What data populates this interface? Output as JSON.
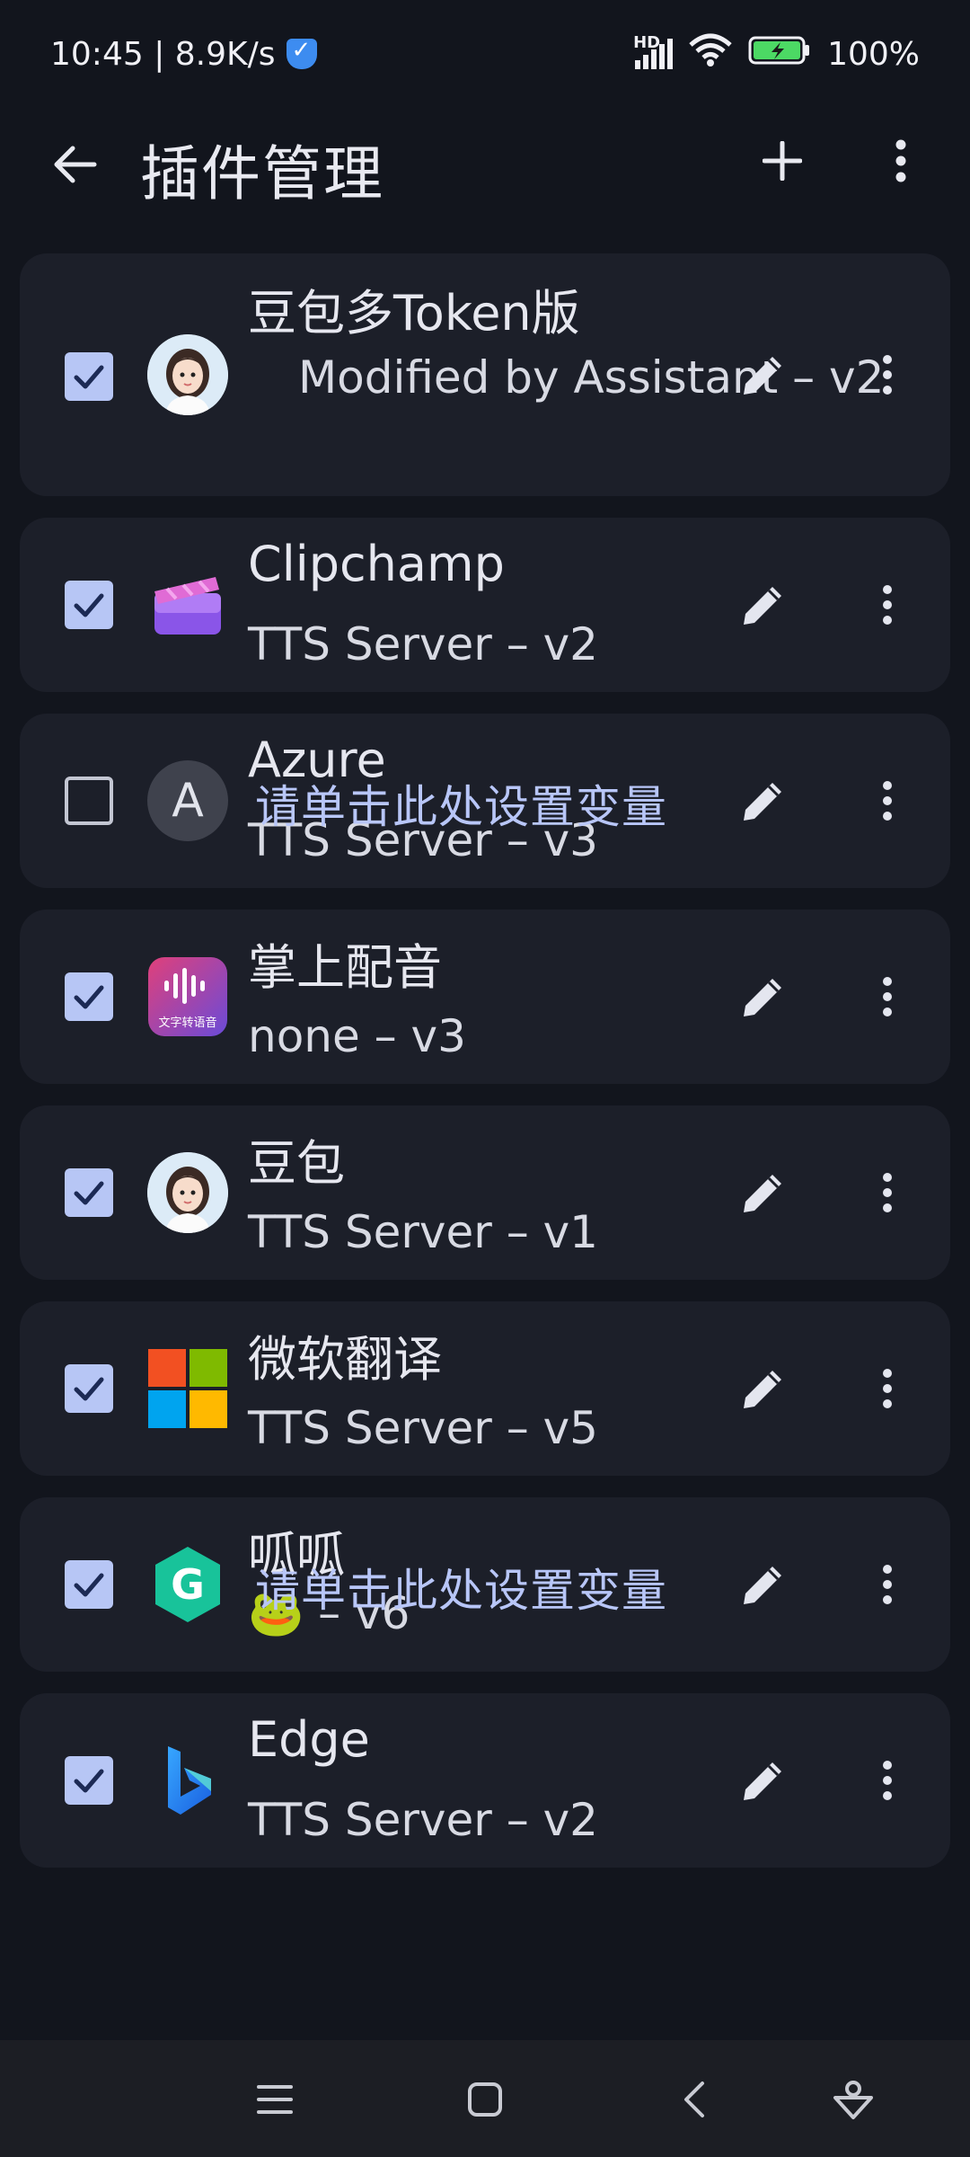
{
  "status": {
    "time_speed": "10:45 | 8.9K/s",
    "network": "HD",
    "battery": "100%"
  },
  "appbar": {
    "title": "插件管理"
  },
  "overlay_text": "请单击此处设置变量",
  "plugins": [
    {
      "name": "豆包多Token版",
      "subtitle": "Modified by Assistant – v2",
      "enabled": true,
      "icon": "girl-avatar-icon"
    },
    {
      "name": "Clipchamp",
      "subtitle": "TTS Server – v2",
      "enabled": true,
      "icon": "clipchamp-icon"
    },
    {
      "name": "Azure",
      "subtitle": "TTS Server – v3",
      "enabled": false,
      "icon": "letter-avatar",
      "letter": "A"
    },
    {
      "name": "掌上配音",
      "subtitle": "none – v3",
      "enabled": true,
      "icon": "voice-app-icon",
      "icon_text": "文字转语音"
    },
    {
      "name": "豆包",
      "subtitle": "TTS Server – v1",
      "enabled": true,
      "icon": "girl-avatar-icon"
    },
    {
      "name": "微软翻译",
      "subtitle": "TTS Server – v5",
      "enabled": true,
      "icon": "microsoft-icon"
    },
    {
      "name": "呱呱",
      "subtitle": "🐸 – v6",
      "enabled": true,
      "icon": "guagua-icon"
    },
    {
      "name": "Edge",
      "subtitle": "TTS Server – v2",
      "enabled": true,
      "icon": "bing-icon"
    }
  ],
  "colors": {
    "background": "#12151d",
    "card": "#1c1f29",
    "checkbox_on": "#b7c6f5",
    "overlay_text": "#b8c6f8"
  }
}
